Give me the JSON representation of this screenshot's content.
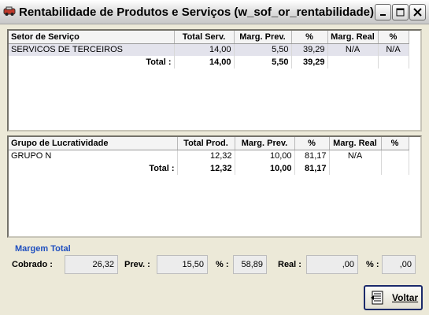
{
  "window": {
    "title": "Rentabilidade de Produtos e Serviços (w_sof_or_rentabilidade)"
  },
  "servicos": {
    "headers": [
      "Setor de Serviço",
      "Total Serv.",
      "Marg. Prev.",
      "%",
      "Marg. Real",
      "%"
    ],
    "rows": [
      [
        "SERVICOS DE TERCEIROS",
        "14,00",
        "5,50",
        "39,29",
        "N/A",
        "N/A"
      ]
    ],
    "total": {
      "label": "Total :",
      "total": "14,00",
      "marg_prev": "5,50",
      "pct": "39,29"
    }
  },
  "produtos": {
    "headers": [
      "Grupo de Lucratividade",
      "Total Prod.",
      "Marg. Prev.",
      "%",
      "Marg. Real",
      "%"
    ],
    "rows": [
      [
        "GRUPO N",
        "12,32",
        "10,00",
        "81,17",
        "N/A",
        ""
      ]
    ],
    "total": {
      "label": "Total :",
      "total": "12,32",
      "marg_prev": "10,00",
      "pct": "81,17"
    }
  },
  "margem": {
    "title": "Margem Total",
    "cobrado_label": "Cobrado :",
    "cobrado": "26,32",
    "prev_label": "Prev. :",
    "prev": "15,50",
    "pct_prev_label": "% :",
    "pct_prev": "58,89",
    "real_label": "Real :",
    "real": ",00",
    "pct_real_label": "% :",
    "pct_real": ",00"
  },
  "buttons": {
    "voltar": "Voltar"
  }
}
